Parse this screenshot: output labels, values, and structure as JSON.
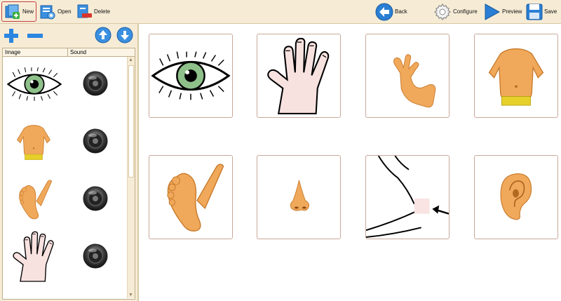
{
  "toolbar": {
    "new_label": "New",
    "open_label": "Open",
    "delete_label": "Delete",
    "back_label": "Back",
    "configure_label": "Configure",
    "preview_label": "Preview",
    "save_label": "Save"
  },
  "list": {
    "columns": [
      "Image",
      "Sound"
    ],
    "rows": [
      {
        "image": "eye-picture",
        "sound": "speaker-icon"
      },
      {
        "image": "torso-picture",
        "sound": "speaker-icon"
      },
      {
        "image": "foot-picture",
        "sound": "speaker-icon"
      },
      {
        "image": "hand-picture",
        "sound": "speaker-icon"
      }
    ]
  },
  "grid": {
    "cards": [
      "eye-picture",
      "hand-picture",
      "arm-picture",
      "torso-picture",
      "foot-picture",
      "nose-picture",
      "elbow-picture",
      "ear-picture"
    ]
  },
  "colors": {
    "toolbar_bg": "#f6ecd6",
    "accent_blue": "#2a7fd4",
    "skin": "#f0a85a",
    "eye_iris": "#8ec08a"
  }
}
